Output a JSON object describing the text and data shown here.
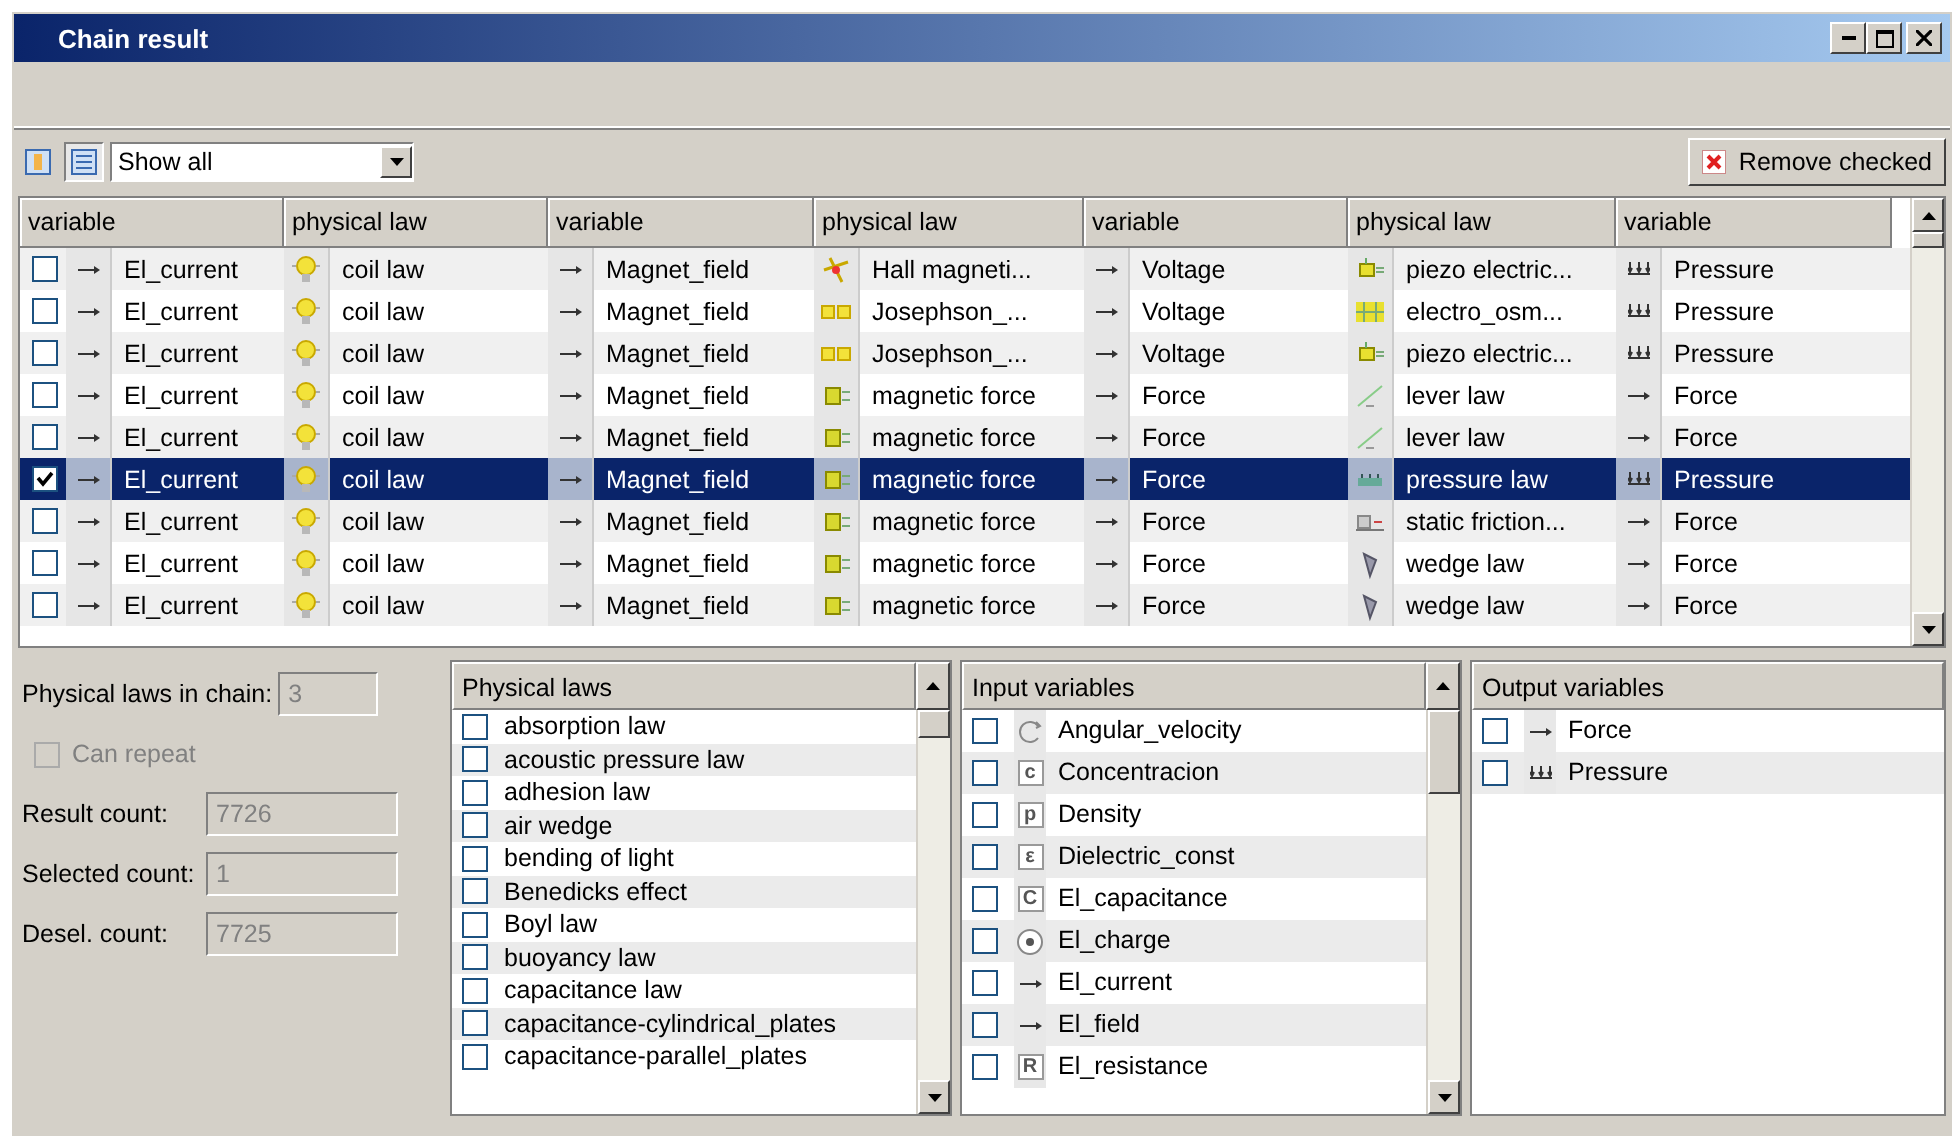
{
  "window": {
    "title": "Chain result"
  },
  "toolbar": {
    "filter": {
      "value": "Show all"
    },
    "remove_button": "Remove checked",
    "view_buttons": [
      {
        "kind": "tree",
        "selected": false
      },
      {
        "kind": "list",
        "selected": true
      }
    ]
  },
  "table": {
    "columns": [
      "variable",
      "physical law",
      "variable",
      "physical law",
      "variable",
      "physical law",
      "variable"
    ],
    "rows": [
      {
        "checked": false,
        "selected": false,
        "cells": [
          {
            "kind": "arrow",
            "text": "El_current"
          },
          {
            "kind": "coil",
            "text": "coil law"
          },
          {
            "kind": "arrow",
            "text": "Magnet_field"
          },
          {
            "kind": "hall",
            "text": "Hall magneti..."
          },
          {
            "kind": "arrow",
            "text": "Voltage"
          },
          {
            "kind": "piezo",
            "text": "piezo electric..."
          },
          {
            "kind": "pressure",
            "text": "Pressure"
          }
        ]
      },
      {
        "checked": false,
        "selected": false,
        "cells": [
          {
            "kind": "arrow",
            "text": "El_current"
          },
          {
            "kind": "coil",
            "text": "coil law"
          },
          {
            "kind": "arrow",
            "text": "Magnet_field"
          },
          {
            "kind": "josephson",
            "text": "Josephson_..."
          },
          {
            "kind": "arrow",
            "text": "Voltage"
          },
          {
            "kind": "osmosis",
            "text": "electro_osm..."
          },
          {
            "kind": "pressure",
            "text": "Pressure"
          }
        ]
      },
      {
        "checked": false,
        "selected": false,
        "cells": [
          {
            "kind": "arrow",
            "text": "El_current"
          },
          {
            "kind": "coil",
            "text": "coil law"
          },
          {
            "kind": "arrow",
            "text": "Magnet_field"
          },
          {
            "kind": "josephson",
            "text": "Josephson_..."
          },
          {
            "kind": "arrow",
            "text": "Voltage"
          },
          {
            "kind": "piezo",
            "text": "piezo electric..."
          },
          {
            "kind": "pressure",
            "text": "Pressure"
          }
        ]
      },
      {
        "checked": false,
        "selected": false,
        "cells": [
          {
            "kind": "arrow",
            "text": "El_current"
          },
          {
            "kind": "coil",
            "text": "coil law"
          },
          {
            "kind": "arrow",
            "text": "Magnet_field"
          },
          {
            "kind": "magnet",
            "text": "magnetic force"
          },
          {
            "kind": "arrow",
            "text": "Force"
          },
          {
            "kind": "lever",
            "text": "lever law"
          },
          {
            "kind": "arrow",
            "text": "Force"
          }
        ]
      },
      {
        "checked": false,
        "selected": false,
        "cells": [
          {
            "kind": "arrow",
            "text": "El_current"
          },
          {
            "kind": "coil",
            "text": "coil law"
          },
          {
            "kind": "arrow",
            "text": "Magnet_field"
          },
          {
            "kind": "magnet",
            "text": "magnetic force"
          },
          {
            "kind": "arrow",
            "text": "Force"
          },
          {
            "kind": "lever",
            "text": "lever law"
          },
          {
            "kind": "arrow",
            "text": "Force"
          }
        ]
      },
      {
        "checked": true,
        "selected": true,
        "cells": [
          {
            "kind": "arrow",
            "text": "El_current"
          },
          {
            "kind": "coil",
            "text": "coil law"
          },
          {
            "kind": "arrow",
            "text": "Magnet_field"
          },
          {
            "kind": "magnet",
            "text": "magnetic force"
          },
          {
            "kind": "arrow",
            "text": "Force"
          },
          {
            "kind": "gauge",
            "text": "pressure law"
          },
          {
            "kind": "pressure",
            "text": "Pressure"
          }
        ]
      },
      {
        "checked": false,
        "selected": false,
        "cells": [
          {
            "kind": "arrow",
            "text": "El_current"
          },
          {
            "kind": "coil",
            "text": "coil law"
          },
          {
            "kind": "arrow",
            "text": "Magnet_field"
          },
          {
            "kind": "magnet",
            "text": "magnetic force"
          },
          {
            "kind": "arrow",
            "text": "Force"
          },
          {
            "kind": "friction",
            "text": "static friction..."
          },
          {
            "kind": "arrow",
            "text": "Force"
          }
        ]
      },
      {
        "checked": false,
        "selected": false,
        "cells": [
          {
            "kind": "arrow",
            "text": "El_current"
          },
          {
            "kind": "coil",
            "text": "coil law"
          },
          {
            "kind": "arrow",
            "text": "Magnet_field"
          },
          {
            "kind": "magnet",
            "text": "magnetic force"
          },
          {
            "kind": "arrow",
            "text": "Force"
          },
          {
            "kind": "wedge",
            "text": "wedge law"
          },
          {
            "kind": "arrow",
            "text": "Force"
          }
        ]
      },
      {
        "checked": false,
        "selected": false,
        "cells": [
          {
            "kind": "arrow",
            "text": "El_current"
          },
          {
            "kind": "coil",
            "text": "coil law"
          },
          {
            "kind": "arrow",
            "text": "Magnet_field"
          },
          {
            "kind": "magnet",
            "text": "magnetic force"
          },
          {
            "kind": "arrow",
            "text": "Force"
          },
          {
            "kind": "wedge",
            "text": "wedge law"
          },
          {
            "kind": "arrow",
            "text": "Force"
          }
        ]
      }
    ]
  },
  "settings": {
    "fields": [
      {
        "label": "Physical laws in chain:",
        "value": "3",
        "disabled": true
      },
      {
        "kind": "checkbox",
        "label": "Can repeat",
        "checked": false,
        "disabled": true
      },
      {
        "label": "Result count:",
        "value": "7726",
        "disabled": true
      },
      {
        "label": "Selected count:",
        "value": "1",
        "disabled": true
      },
      {
        "label": "Desel. count:",
        "value": "7725",
        "disabled": true
      }
    ]
  },
  "physical_laws": {
    "title": "Physical laws",
    "items": [
      {
        "label": "absorption law",
        "checked": false
      },
      {
        "label": "acoustic pressure law",
        "checked": false
      },
      {
        "label": "adhesion law",
        "checked": false
      },
      {
        "label": "air wedge",
        "checked": false
      },
      {
        "label": "bending of light",
        "checked": false
      },
      {
        "label": "Benedicks effect",
        "checked": false
      },
      {
        "label": "Boyl law",
        "checked": false
      },
      {
        "label": "buoyancy law",
        "checked": false
      },
      {
        "label": "capacitance law",
        "checked": false
      },
      {
        "label": "capacitance-cylindrical_plates",
        "checked": false
      },
      {
        "label": "capacitance-parallel_plates",
        "checked": false
      }
    ]
  },
  "input_variables": {
    "title": "Input variables",
    "items": [
      {
        "label": "Angular_velocity",
        "checked": false,
        "kind": "rotation"
      },
      {
        "label": "Concentracion",
        "checked": false,
        "kind": "letter",
        "symbol": "c"
      },
      {
        "label": "Density",
        "checked": false,
        "kind": "letter",
        "symbol": "p"
      },
      {
        "label": "Dielectric_const",
        "checked": false,
        "kind": "letter",
        "symbol": "ε"
      },
      {
        "label": "El_capacitance",
        "checked": false,
        "kind": "letter",
        "symbol": "C"
      },
      {
        "label": "El_charge",
        "checked": false,
        "kind": "charge"
      },
      {
        "label": "El_current",
        "checked": false,
        "kind": "arrow"
      },
      {
        "label": "El_field",
        "checked": false,
        "kind": "arrow"
      },
      {
        "label": "El_resistance",
        "checked": false,
        "kind": "letter",
        "symbol": "R"
      }
    ]
  },
  "output_variables": {
    "title": "Output variables",
    "items": [
      {
        "label": "Force",
        "checked": false,
        "kind": "arrow"
      },
      {
        "label": "Pressure",
        "checked": false,
        "kind": "pressure"
      }
    ]
  }
}
